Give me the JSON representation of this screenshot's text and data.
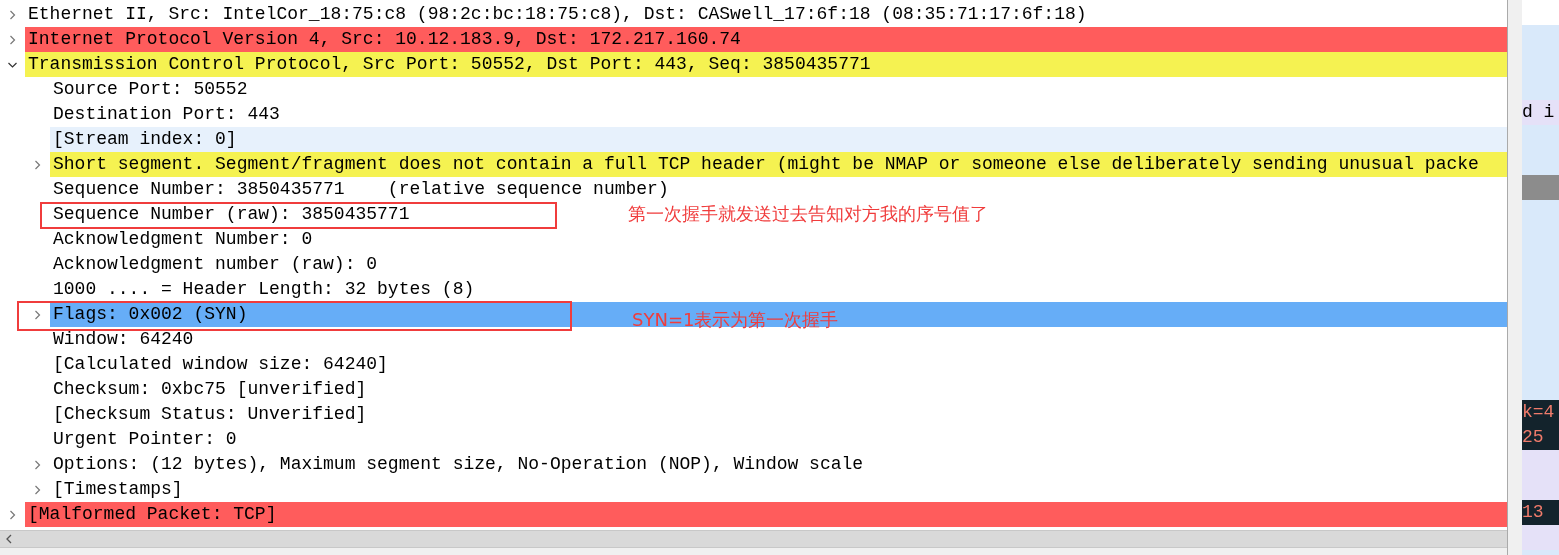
{
  "tree": [
    {
      "text": "Ethernet II, Src: IntelCor_18:75:c8 (98:2c:bc:18:75:c8), Dst: CASwell_17:6f:18 (08:35:71:17:6f:18)",
      "expanded": false,
      "expandable": true,
      "selected": false
    },
    {
      "text": "Internet Protocol Version 4, Src: 10.12.183.9, Dst: 172.217.160.74",
      "expanded": false,
      "expandable": true,
      "selected": false,
      "color": "#ff5c5c"
    },
    {
      "text": "Transmission Control Protocol, Src Port: 50552, Dst Port: 443, Seq: 3850435771",
      "expanded": true,
      "expandable": true,
      "selected": false,
      "color": "#f5f251",
      "children": [
        {
          "text": "Source Port: 50552",
          "expandable": false,
          "selected": false
        },
        {
          "text": "Destination Port: 443",
          "expandable": false,
          "selected": false
        },
        {
          "text": "[Stream index: 0]",
          "expandable": false,
          "selected": false,
          "color": "#e7f1fc"
        },
        {
          "text": "Short segment. Segment/fragment does not contain a full TCP header (might be NMAP or someone else deliberately sending unusual packe",
          "expandable": true,
          "expanded": false,
          "selected": false,
          "color": "#f5f251"
        },
        {
          "text": "Sequence Number: 3850435771    (relative sequence number)",
          "expandable": false,
          "selected": false
        },
        {
          "text": "Sequence Number (raw): 3850435771",
          "expandable": false,
          "selected": false,
          "boxed": true,
          "note": "第一次握手就发送过去告知对方我的序号值了"
        },
        {
          "text": "Acknowledgment Number: 0",
          "expandable": false,
          "selected": false
        },
        {
          "text": "Acknowledgment number (raw): 0",
          "expandable": false,
          "selected": false
        },
        {
          "text": "1000 .... = Header Length: 32 bytes (8)",
          "expandable": false,
          "selected": false
        },
        {
          "text": "Flags: 0x002 (SYN)",
          "expandable": true,
          "expanded": false,
          "selected": true,
          "boxed": true,
          "note": "SYN=1表示为第一次握手"
        },
        {
          "text": "Window: 64240",
          "expandable": false,
          "selected": false
        },
        {
          "text": "[Calculated window size: 64240]",
          "expandable": false,
          "selected": false
        },
        {
          "text": "Checksum: 0xbc75 [unverified]",
          "expandable": false,
          "selected": false
        },
        {
          "text": "[Checksum Status: Unverified]",
          "expandable": false,
          "selected": false
        },
        {
          "text": "Urgent Pointer: 0",
          "expandable": false,
          "selected": false
        },
        {
          "text": "Options: (12 bytes), Maximum segment size, No-Operation (NOP), Window scale",
          "expandable": true,
          "expanded": false,
          "selected": false
        },
        {
          "text": "[Timestamps]",
          "expandable": true,
          "expanded": false,
          "selected": false
        }
      ]
    },
    {
      "text": "[Malformed Packet: TCP]",
      "expanded": false,
      "expandable": true,
      "selected": false,
      "color": "#ff5c5c"
    }
  ],
  "side_pane": [
    {
      "kind": "blank"
    },
    {
      "kind": "light"
    },
    {
      "kind": "light"
    },
    {
      "kind": "light"
    },
    {
      "kind": "lavender",
      "text": "d i"
    },
    {
      "kind": "light"
    },
    {
      "kind": "light"
    },
    {
      "kind": "grey"
    },
    {
      "kind": "light"
    },
    {
      "kind": "light"
    },
    {
      "kind": "light"
    },
    {
      "kind": "light"
    },
    {
      "kind": "light"
    },
    {
      "kind": "light"
    },
    {
      "kind": "light"
    },
    {
      "kind": "light"
    },
    {
      "kind": "dark",
      "text": "k=4"
    },
    {
      "kind": "dark",
      "text": "25"
    },
    {
      "kind": "lavender"
    },
    {
      "kind": "lavender"
    },
    {
      "kind": "dark",
      "text": "13"
    },
    {
      "kind": "lavender"
    }
  ]
}
